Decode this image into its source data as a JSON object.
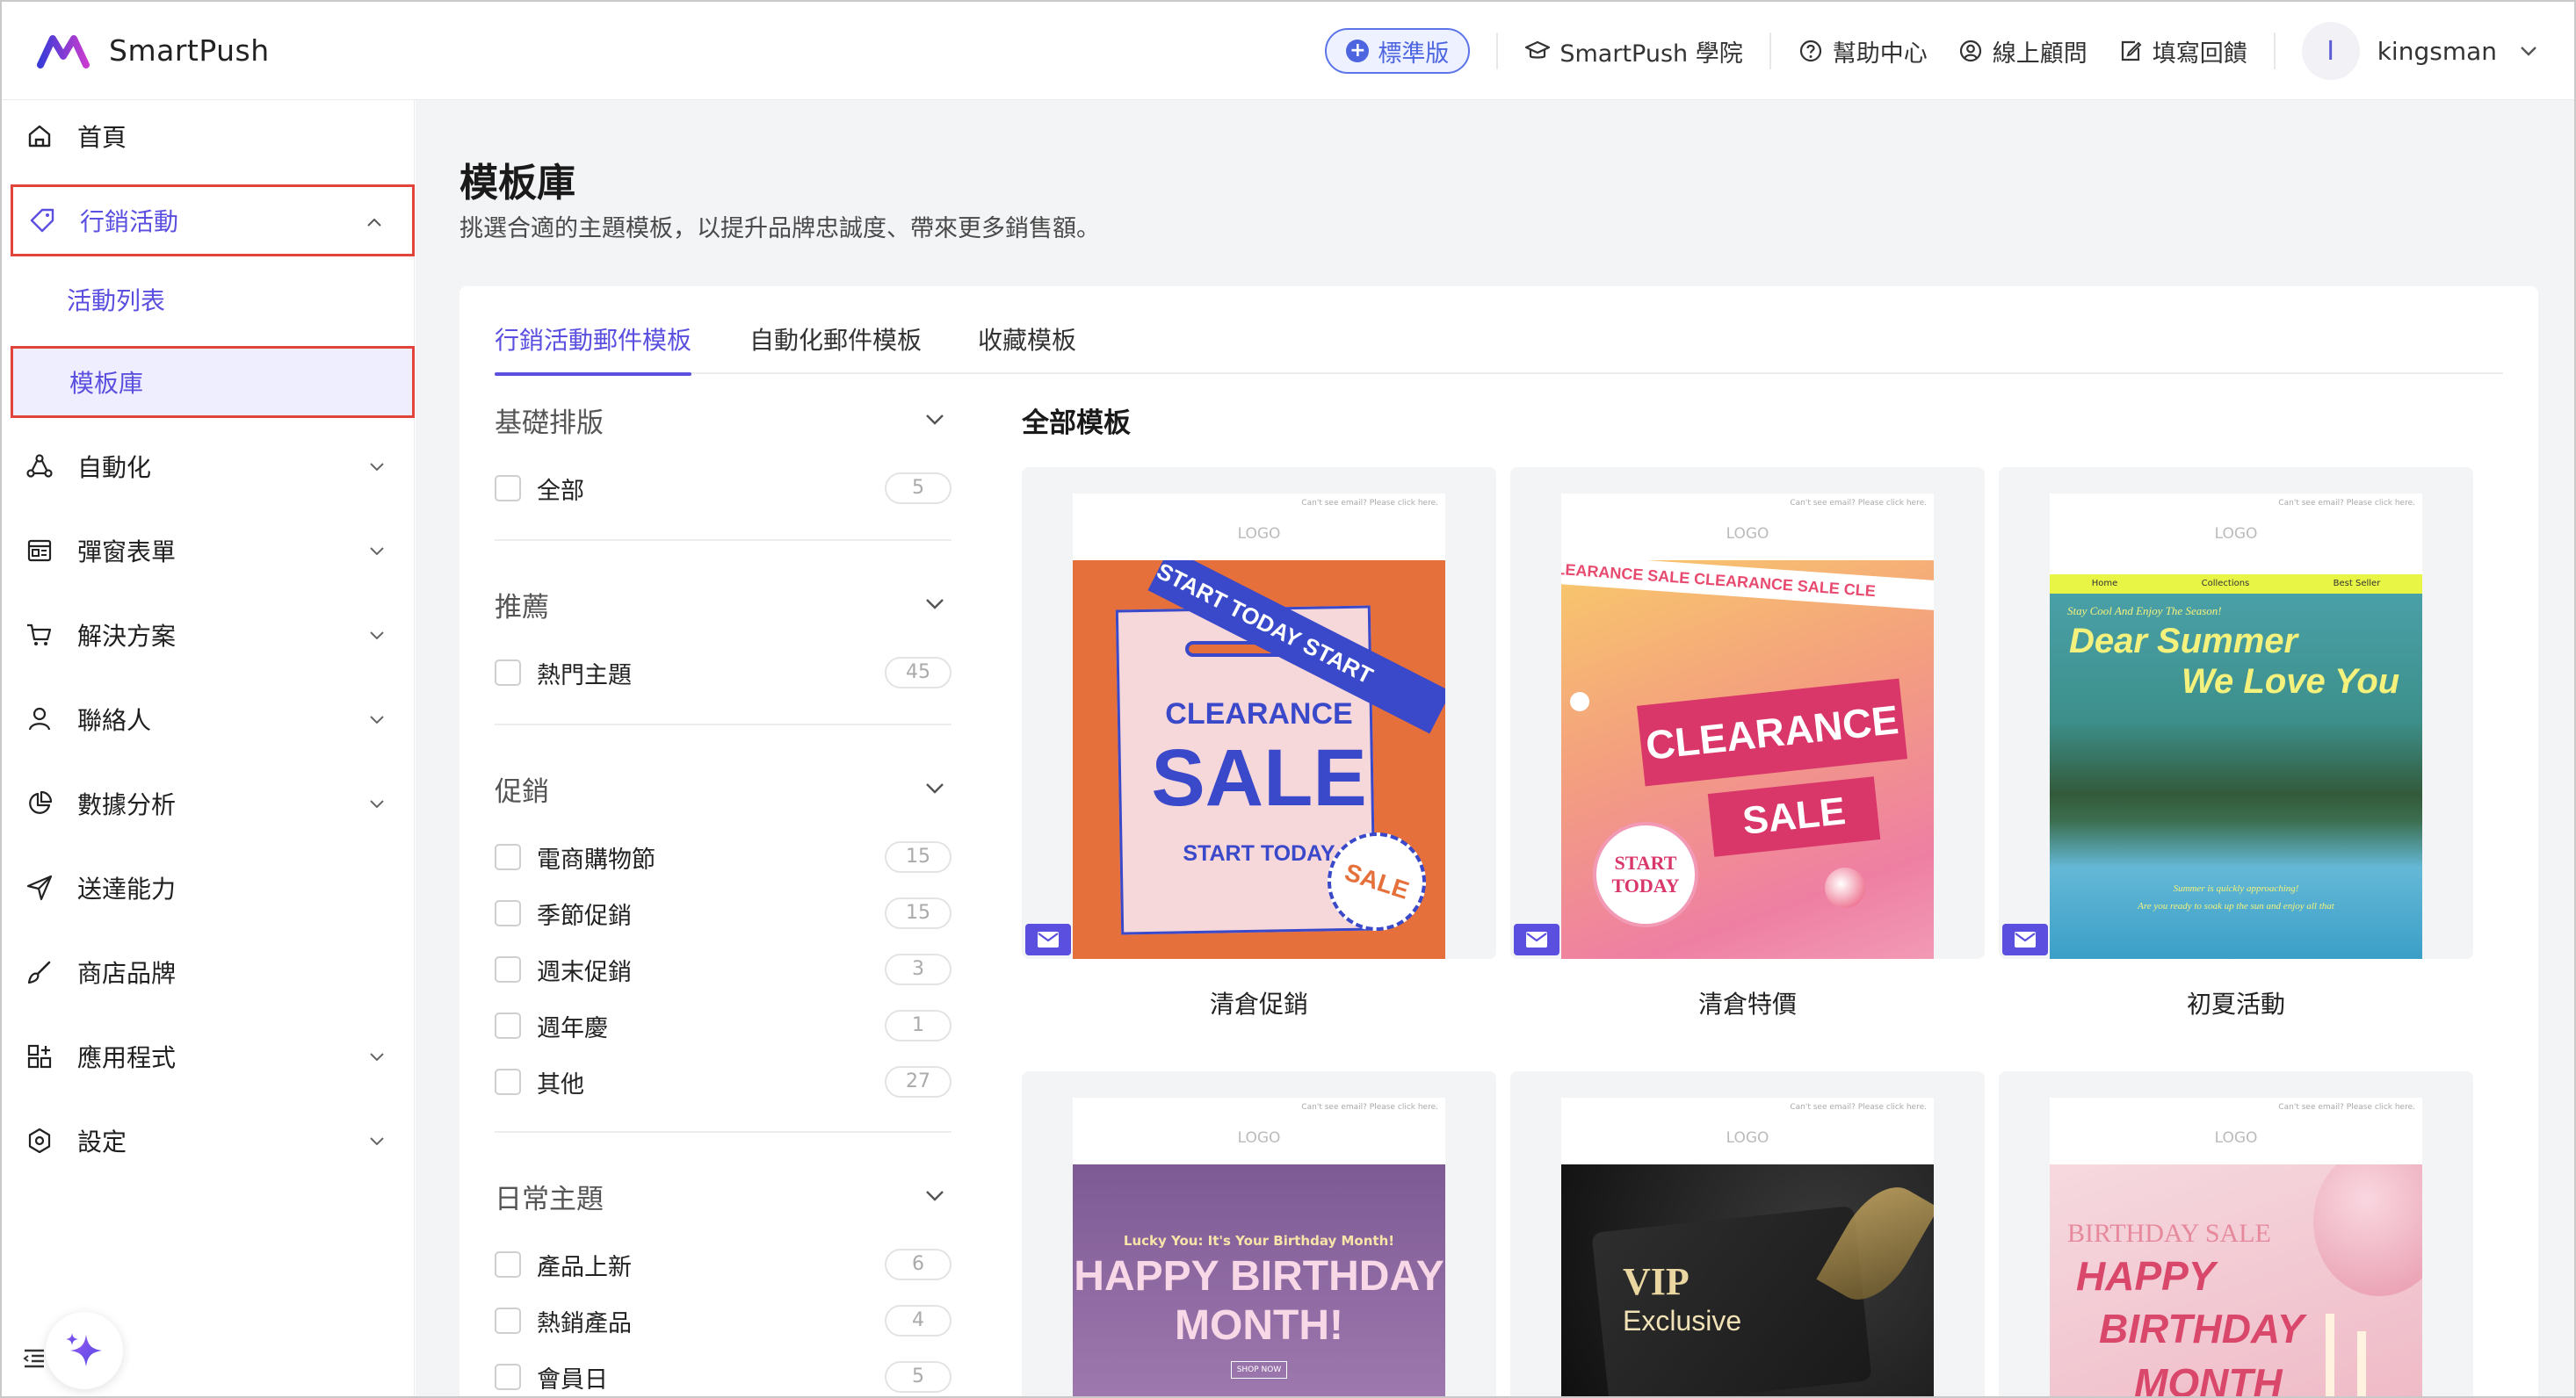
{
  "header": {
    "brand": "SmartPush",
    "plan": "標準版",
    "academy": "SmartPush 學院",
    "help": "幫助中心",
    "consultant": "線上顧問",
    "feedback": "填寫回饋",
    "avatar_letter": "I",
    "username": "kingsman"
  },
  "sidebar": {
    "items": [
      {
        "label": "首頁"
      },
      {
        "label": "行銷活動"
      },
      {
        "label": "自動化"
      },
      {
        "label": "彈窗表單"
      },
      {
        "label": "解決方案"
      },
      {
        "label": "聯絡人"
      },
      {
        "label": "數據分析"
      },
      {
        "label": "送達能力"
      },
      {
        "label": "商店品牌"
      },
      {
        "label": "應用程式"
      },
      {
        "label": "設定"
      }
    ],
    "subitems": [
      {
        "label": "活動列表"
      },
      {
        "label": "模板庫"
      }
    ]
  },
  "page": {
    "title": "模板庫",
    "subtitle": "挑選合適的主題模板，以提升品牌忠誠度、帶來更多銷售額。"
  },
  "tabs": [
    {
      "label": "行銷活動郵件模板"
    },
    {
      "label": "自動化郵件模板"
    },
    {
      "label": "收藏模板"
    }
  ],
  "filters": [
    {
      "title": "基礎排版",
      "options": [
        {
          "label": "全部",
          "count": "5"
        }
      ]
    },
    {
      "title": "推薦",
      "options": [
        {
          "label": "熱門主題",
          "count": "45"
        }
      ]
    },
    {
      "title": "促銷",
      "options": [
        {
          "label": "電商購物節",
          "count": "15"
        },
        {
          "label": "季節促銷",
          "count": "15"
        },
        {
          "label": "週末促銷",
          "count": "3"
        },
        {
          "label": "週年慶",
          "count": "1"
        },
        {
          "label": "其他",
          "count": "27"
        }
      ]
    },
    {
      "title": "日常主題",
      "options": [
        {
          "label": "產品上新",
          "count": "6"
        },
        {
          "label": "熱銷產品",
          "count": "4"
        },
        {
          "label": "會員日",
          "count": "5"
        }
      ]
    }
  ],
  "grid": {
    "title": "全部模板",
    "mini_header": "Can't see email? Please click here.",
    "logo_text": "LOGO",
    "templates": [
      {
        "name": "清倉促銷",
        "art": {
          "ribbon": "START TODAY   START",
          "line1": "CLEARANCE",
          "line2": "SALE",
          "line3": "START TODAY",
          "badge": "SALE"
        }
      },
      {
        "name": "清倉特價",
        "art": {
          "ribbon": "CLEARANCE SALE   CLEARANCE SALE   CLE",
          "line1": "CLEARANCE",
          "line2": "SALE",
          "badge1": "START",
          "badge2": "TODAY"
        }
      },
      {
        "name": "初夏活動",
        "art": {
          "nav1": "Home",
          "nav2": "Collections",
          "nav3": "Best Seller",
          "tagline": "Stay Cool And Enjoy The Season!",
          "line1": "Dear Summer",
          "line2": "We Love You",
          "foot1": "Summer is quickly approaching!",
          "foot2": "Are you ready to soak up the sun and enjoy all that"
        }
      },
      {
        "name": "",
        "art": {
          "tagline": "Lucky You: It's Your Birthday Month!",
          "line1": "HAPPY BIRTHDAY",
          "line2": "MONTH!",
          "btn": "SHOP NOW"
        }
      },
      {
        "name": "",
        "art": {
          "line1": "VIP",
          "line2": "Exclusive"
        }
      },
      {
        "name": "",
        "art": {
          "line0": "BIRTHDAY SALE",
          "line1": "HAPPY",
          "line2": "BIRTHDAY",
          "line3": "MONTH"
        }
      }
    ]
  },
  "colors": {
    "accent": "#5b4fe0",
    "highlight_border": "#e0443a",
    "plan_blue": "#4d66e0"
  }
}
